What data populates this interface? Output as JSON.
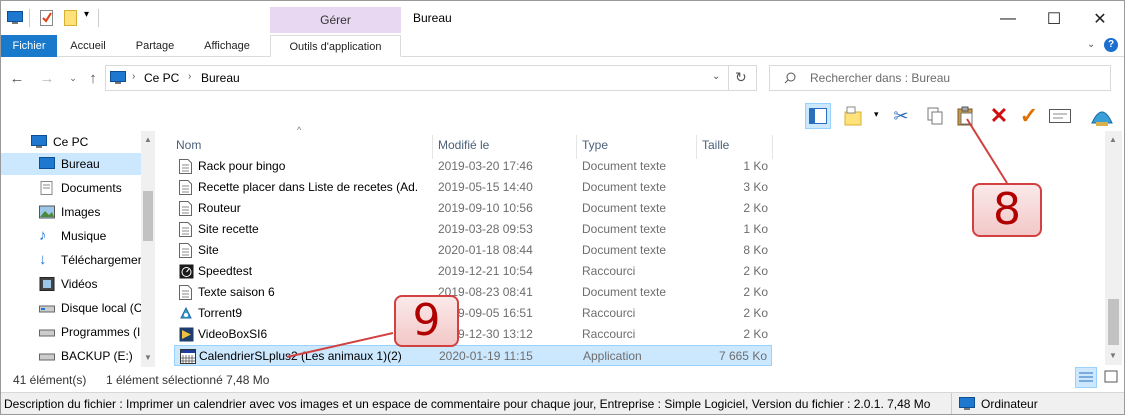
{
  "window": {
    "title": "Bureau",
    "context_group": "Gérer",
    "controls": {
      "minimize": "—",
      "maximize": "☐",
      "close": "✕"
    }
  },
  "ribbon": {
    "tabs": [
      "Fichier",
      "Accueil",
      "Partage",
      "Affichage",
      "Outils d'application"
    ]
  },
  "address": {
    "path": [
      "Ce PC",
      "Bureau"
    ],
    "search_placeholder": "Rechercher dans : Bureau"
  },
  "nav_pane": {
    "items": [
      {
        "label": "Ce PC",
        "icon": "computer-icon"
      },
      {
        "label": "Bureau",
        "icon": "desktop-icon"
      },
      {
        "label": "Documents",
        "icon": "documents-icon"
      },
      {
        "label": "Images",
        "icon": "images-icon"
      },
      {
        "label": "Musique",
        "icon": "music-icon"
      },
      {
        "label": "Téléchargemer",
        "icon": "download-icon"
      },
      {
        "label": "Vidéos",
        "icon": "videos-icon"
      },
      {
        "label": "Disque local (C",
        "icon": "drive-icon"
      },
      {
        "label": "Programmes (I",
        "icon": "drive-icon"
      },
      {
        "label": "BACKUP (E:)",
        "icon": "drive-icon"
      }
    ]
  },
  "columns": {
    "name": "Nom",
    "modified": "Modifié le",
    "type": "Type",
    "size": "Taille"
  },
  "files": [
    {
      "name": "Rack pour bingo",
      "modified": "2019-03-20 17:46",
      "type": "Document texte",
      "size": "1 Ko",
      "icon": "text-file-icon"
    },
    {
      "name": "Recette placer dans Liste de recetes (Ad...",
      "modified": "2019-05-15 14:40",
      "type": "Document texte",
      "size": "3 Ko",
      "icon": "text-file-icon"
    },
    {
      "name": "Routeur",
      "modified": "2019-09-10 10:56",
      "type": "Document texte",
      "size": "2 Ko",
      "icon": "text-file-icon"
    },
    {
      "name": "Site recette",
      "modified": "2019-03-28 09:53",
      "type": "Document texte",
      "size": "1 Ko",
      "icon": "text-file-icon"
    },
    {
      "name": "Site",
      "modified": "2020-01-18 08:44",
      "type": "Document texte",
      "size": "8 Ko",
      "icon": "text-file-icon"
    },
    {
      "name": "Speedtest",
      "modified": "2019-12-21 10:54",
      "type": "Raccourci",
      "size": "2 Ko",
      "icon": "speedtest-shortcut-icon"
    },
    {
      "name": "Texte saison 6",
      "modified": "2019-08-23 08:41",
      "type": "Document texte",
      "size": "2 Ko",
      "icon": "text-file-icon"
    },
    {
      "name": "Torrent9",
      "modified": "2019-09-05 16:51",
      "type": "Raccourci",
      "size": "2 Ko",
      "icon": "torrent-shortcut-icon"
    },
    {
      "name": "VideoBoxSI6",
      "modified": "2019-12-30 13:12",
      "type": "Raccourci",
      "size": "2 Ko",
      "icon": "video-shortcut-icon"
    },
    {
      "name": "CalendrierSLplus2 (Les animaux 1)(2)",
      "modified": "2020-01-19 11:15",
      "type": "Application",
      "size": "7 665 Ko",
      "icon": "application-icon"
    }
  ],
  "callouts": {
    "eight": "8",
    "nine": "9"
  },
  "status": {
    "count": "41 élément(s)",
    "selection": "1 élément sélectionné  7,48 Mo"
  },
  "description": {
    "text": "Description du fichier : Imprimer un calendrier avec vos images et un espace de commentaire pour chaque jour, Entreprise : Simple Logiciel, Version du fichier : 2.0.1. 7,48 Mo",
    "location": "Ordinateur"
  }
}
